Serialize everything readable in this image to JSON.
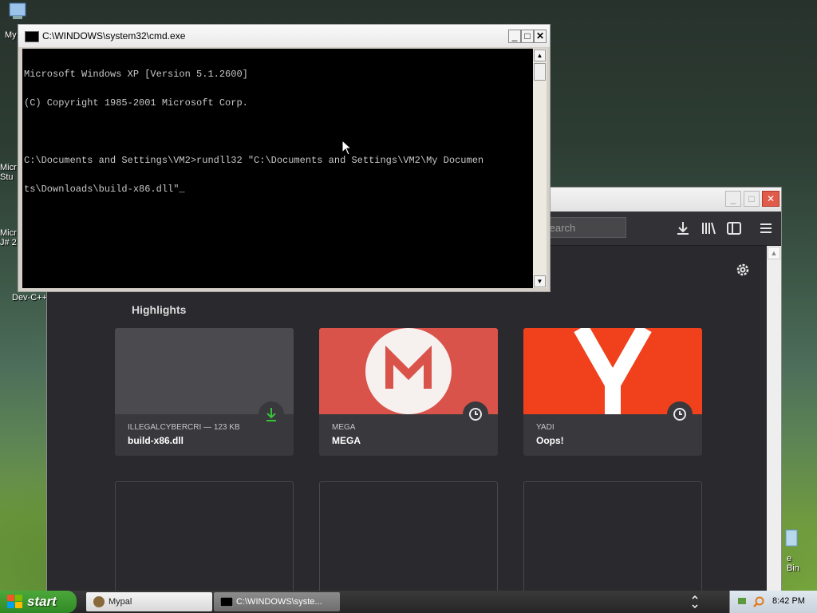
{
  "desktop": {
    "icons": [
      {
        "label": "My",
        "name": "my-computer"
      },
      {
        "label": "Micr\nStu",
        "name": "microsoft-studio"
      },
      {
        "label": "Micr\nJ# 2",
        "name": "microsoft-jsharp"
      },
      {
        "label": "Dev-C++",
        "name": "dev-cpp"
      },
      {
        "label": "e Bin",
        "name": "recycle-bin"
      }
    ]
  },
  "cmd": {
    "title": "C:\\WINDOWS\\system32\\cmd.exe",
    "lines": [
      "Microsoft Windows XP [Version 5.1.2600]",
      "(C) Copyright 1985-2001 Microsoft Corp.",
      "",
      "C:\\Documents and Settings\\VM2>rundll32 \"C:\\Documents and Settings\\VM2\\My Documen",
      "ts\\Downloads\\build-x86.dll\"_"
    ],
    "minimize": "_",
    "maximize": "□",
    "close": "✕"
  },
  "browser": {
    "search_placeholder": "Search",
    "section_title": "Highlights",
    "cards": [
      {
        "meta": "ILLEGALCYBERCRI — 123 KB",
        "name": "build-x86.dll",
        "thumb_color": "#4a4a4f",
        "badge": "download-icon"
      },
      {
        "meta": "MEGA",
        "name": "MEGA",
        "thumb_color": "#d9534a",
        "badge": "clock-icon"
      },
      {
        "meta": "YADI",
        "name": "Oops!",
        "thumb_color": "#f0401c",
        "badge": "clock-icon"
      }
    ]
  },
  "taskbar": {
    "start_label": "start",
    "tasks": [
      {
        "label": "Mypal",
        "active": false
      },
      {
        "label": "C:\\WINDOWS\\syste...",
        "active": true
      }
    ],
    "clock": "8:42 PM"
  }
}
